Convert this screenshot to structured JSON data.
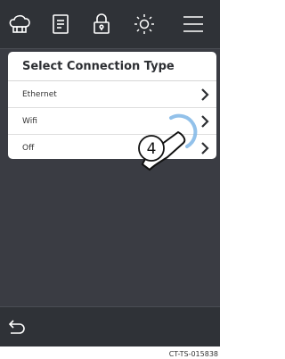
{
  "topbar": {
    "icons": [
      "chef-hat-icon",
      "recipe-list-icon",
      "lock-icon",
      "brightness-icon",
      "menu-icon"
    ]
  },
  "panel": {
    "title": "Select Connection Type",
    "options": [
      {
        "label": "Ethernet"
      },
      {
        "label": "Wifi"
      },
      {
        "label": "Off"
      }
    ]
  },
  "annotation": {
    "step": "4"
  },
  "bottombar": {
    "back_icon": "back-arrow-icon"
  },
  "footer": {
    "code": "CT-TS-015838"
  },
  "colors": {
    "background": "#3a3c43",
    "bar": "#2f3237",
    "panel": "#ffffff",
    "tap_ring": "#7fb6e6"
  }
}
